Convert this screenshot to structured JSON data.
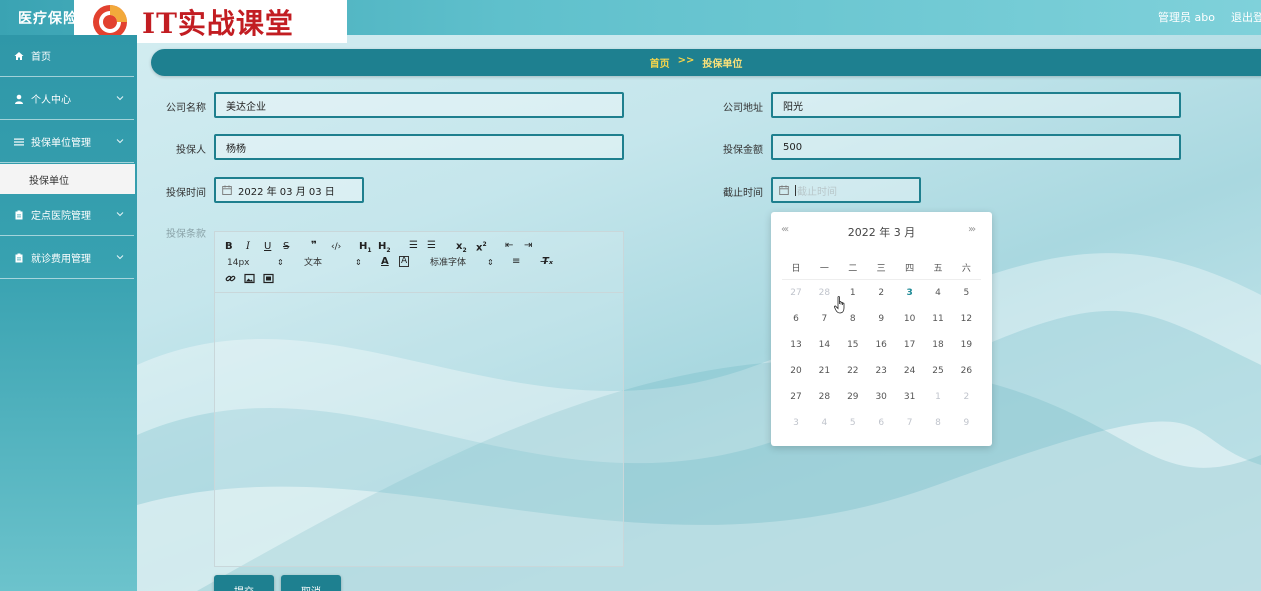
{
  "header": {
    "app_title": "医疗保险",
    "watermark_text": "IT实战课堂",
    "user": "管理员 abo",
    "logout": "退出登"
  },
  "sidebar": {
    "items": [
      {
        "label": "首页",
        "icon": "home-icon"
      },
      {
        "label": "个人中心",
        "icon": "user-icon"
      },
      {
        "label": "投保单位管理",
        "icon": "list-icon"
      },
      {
        "label": "定点医院管理",
        "icon": "clipboard-icon"
      },
      {
        "label": "就诊费用管理",
        "icon": "clipboard-icon"
      }
    ],
    "sub_item": "投保单位"
  },
  "breadcrumb": {
    "home": "首页",
    "sep": ">>",
    "current": "投保单位"
  },
  "form": {
    "company_name_label": "公司名称",
    "company_name_value": "美达企业",
    "company_address_label": "公司地址",
    "company_address_value": "阳光",
    "insurer_label": "投保人",
    "insurer_value": "杨杨",
    "amount_label": "投保金额",
    "amount_value": "500",
    "insure_time_label": "投保时间",
    "insure_time_value": "2022 年 03 月 03 日",
    "end_time_label": "截止时间",
    "end_time_placeholder": "截止时间",
    "terms_label": "投保条款"
  },
  "editor": {
    "font_size": "14px",
    "text_type": "文本",
    "font_family": "标准字体"
  },
  "buttons": {
    "submit": "提交",
    "cancel": "取消"
  },
  "calendar": {
    "prev": "«‹",
    "next": "›»",
    "title": "2022 年  3 月",
    "weekdays": [
      "日",
      "一",
      "二",
      "三",
      "四",
      "五",
      "六"
    ],
    "weeks": [
      [
        "27",
        "28",
        "1",
        "2",
        "3",
        "4",
        "5"
      ],
      [
        "6",
        "7",
        "8",
        "9",
        "10",
        "11",
        "12"
      ],
      [
        "13",
        "14",
        "15",
        "16",
        "17",
        "18",
        "19"
      ],
      [
        "20",
        "21",
        "22",
        "23",
        "24",
        "25",
        "26"
      ],
      [
        "27",
        "28",
        "29",
        "30",
        "31",
        "1",
        "2"
      ],
      [
        "3",
        "4",
        "5",
        "6",
        "7",
        "8",
        "9"
      ]
    ],
    "today": "3"
  },
  "colors": {
    "accent": "#1e8090",
    "breadcrumb_text": "#f7d54a",
    "watermark": "#c21d22"
  }
}
